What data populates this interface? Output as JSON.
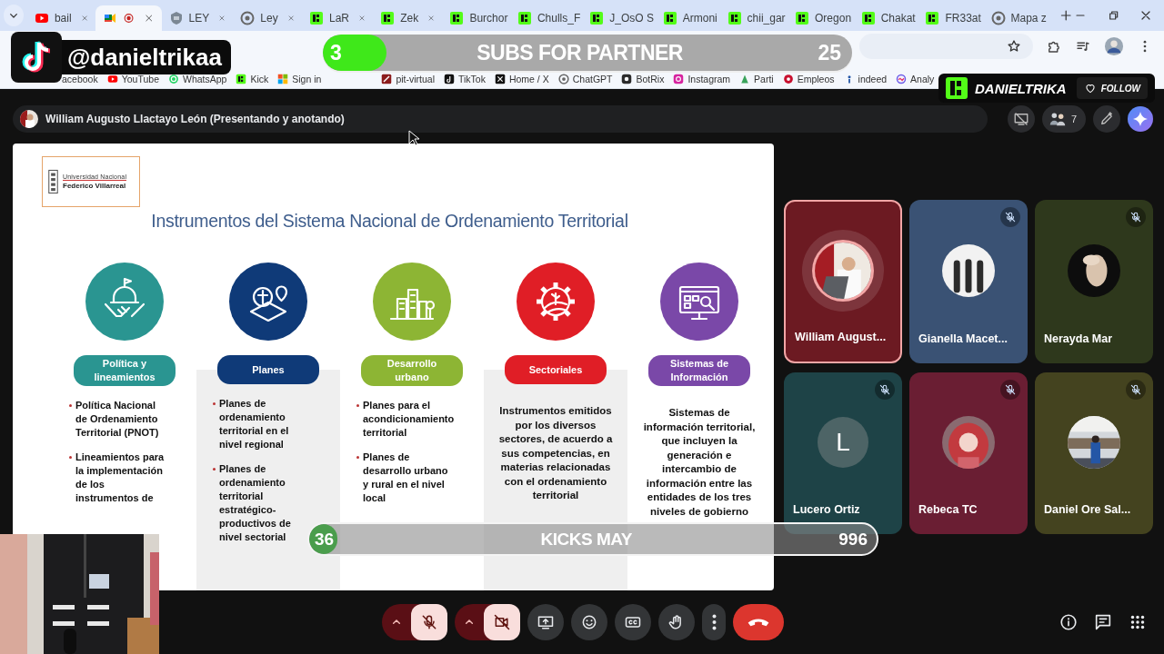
{
  "browser": {
    "tabs": [
      {
        "label": "bail",
        "kind": "youtube",
        "selected": false,
        "recording": false,
        "closable": true
      },
      {
        "kind": "meet",
        "selected": true,
        "recording": true,
        "closable": true
      },
      {
        "label": "LEY",
        "kind": "crest",
        "selected": false,
        "recording": false,
        "closable": true
      },
      {
        "label": "Ley",
        "kind": "swirl",
        "selected": false,
        "recording": false,
        "closable": true
      },
      {
        "label": "LaR",
        "kind": "kick",
        "selected": false,
        "recording": false,
        "closable": true
      },
      {
        "label": "Zek",
        "kind": "kick",
        "selected": false,
        "recording": false,
        "closable": true
      },
      {
        "label": "Burchor",
        "kind": "kick",
        "selected": false,
        "recording": false,
        "closable": false
      },
      {
        "label": "Chulls_F",
        "kind": "kick",
        "selected": false,
        "recording": false,
        "closable": false
      },
      {
        "label": "J_OsO S",
        "kind": "kick",
        "selected": false,
        "recording": false,
        "closable": false
      },
      {
        "label": "Armoni",
        "kind": "kick",
        "selected": false,
        "recording": false,
        "closable": false
      },
      {
        "label": "chii_gar",
        "kind": "kick",
        "selected": false,
        "recording": false,
        "closable": false
      },
      {
        "label": "Oregon",
        "kind": "kick",
        "selected": false,
        "recording": false,
        "closable": false
      },
      {
        "label": "Chakat",
        "kind": "kick",
        "selected": false,
        "recording": false,
        "closable": false
      },
      {
        "label": "FR33at",
        "kind": "kick",
        "selected": false,
        "recording": false,
        "closable": false
      },
      {
        "label": "Mapa z",
        "kind": "swirl",
        "selected": false,
        "recording": false,
        "closable": false
      }
    ],
    "bookmarks": [
      {
        "label": "acebook",
        "kind": "none"
      },
      {
        "label": "YouTube",
        "kind": "youtube"
      },
      {
        "label": "WhatsApp",
        "kind": "whatsapp"
      },
      {
        "label": "Kick",
        "kind": "kick"
      },
      {
        "label": "Sign in",
        "kind": "windows"
      },
      {
        "label": "pit-virtual",
        "kind": "pit"
      },
      {
        "label": "TikTok",
        "kind": "tiktok"
      },
      {
        "label": "Home / X",
        "kind": "x"
      },
      {
        "label": "ChatGPT",
        "kind": "swirl"
      },
      {
        "label": "BotRix",
        "kind": "botrix"
      },
      {
        "label": "Instagram",
        "kind": "instagram"
      },
      {
        "label": "Parti",
        "kind": "parti"
      },
      {
        "label": "Empleos",
        "kind": "empleos"
      },
      {
        "label": "indeed",
        "kind": "indeed"
      },
      {
        "label": "Analy",
        "kind": "analytics"
      }
    ]
  },
  "stream_overlays": {
    "tiktok_handle": "@danieltrikaa",
    "subs_goal": {
      "count": "3",
      "title": "SUBS FOR PARTNER",
      "target": "25",
      "level": 0.12
    },
    "kick_badge": {
      "channel": "DANIELTRIKA",
      "follow": "FOLLOW"
    },
    "kicks_goal": {
      "count": "36",
      "title": "KICKS MAY",
      "target": "996",
      "level": 0.05
    }
  },
  "meet": {
    "presenter": "William Augusto Llactayo León (Presentando y anotando)",
    "participant_count": "7",
    "slide": {
      "logo_lines": [
        "Universidad Nacional",
        "Federico Villarreal"
      ],
      "title": "Instrumentos del Sistema Nacional de Ordenamiento Territorial",
      "columns": [
        {
          "heading": "Política y lineamientos",
          "color": "#2a9591",
          "shaded": false,
          "kind": "bullets",
          "items": [
            "Política Nacional de Ordenamiento Territorial (PNOT)",
            "Lineamientos para la implementación de los instrumentos de"
          ]
        },
        {
          "heading": "Planes",
          "color": "#0f3a78",
          "shaded": true,
          "kind": "bullets",
          "items": [
            "Planes de ordenamiento territorial en el nivel regional",
            "Planes de ordenamiento territorial estratégico-productivos de nivel sectorial"
          ]
        },
        {
          "heading": "Desarrollo urbano",
          "color": "#8db534",
          "shaded": false,
          "kind": "bullets",
          "items": [
            "Planes para el acondicionamiento territorial",
            "Planes de desarrollo urbano y rural en el nivel local"
          ]
        },
        {
          "heading": "Sectoriales",
          "color": "#e01e26",
          "shaded": true,
          "kind": "paragraph",
          "text": "Instrumentos emitidos por los diversos sectores, de acuerdo a sus competencias, en materias relacionadas con el ordenamiento territorial"
        },
        {
          "heading": "Sistemas de Información",
          "color": "#7a48a8",
          "shaded": false,
          "kind": "paragraph",
          "text": "Sistemas de información territorial, que incluyen la generación e intercambio de información entre las entidades de los tres niveles de gobierno"
        }
      ]
    },
    "participants": [
      {
        "name": "William August...",
        "color": "#6c1a22",
        "muted": false,
        "speaking": true
      },
      {
        "name": "Gianella Macet...",
        "color": "#3a5274",
        "muted": true,
        "speaking": false
      },
      {
        "name": "Nerayda Mar",
        "color": "#2e381c",
        "muted": true,
        "speaking": false
      },
      {
        "name": "Lucero Ortiz",
        "color": "#1e4347",
        "muted": true,
        "speaking": false,
        "avatar": {
          "kind": "letter",
          "initial": "L"
        }
      },
      {
        "name": "Rebeca TC",
        "color": "#6a1e33",
        "muted": true,
        "speaking": false
      },
      {
        "name": "Daniel Ore Sal...",
        "color": "#44431f",
        "muted": true,
        "speaking": false
      }
    ],
    "controls": [
      {
        "kind": "mic",
        "on": false
      },
      {
        "kind": "camera",
        "on": false
      },
      {
        "kind": "present"
      },
      {
        "kind": "emoji"
      },
      {
        "kind": "captions"
      },
      {
        "kind": "hand"
      },
      {
        "kind": "more"
      },
      {
        "kind": "end"
      }
    ]
  }
}
